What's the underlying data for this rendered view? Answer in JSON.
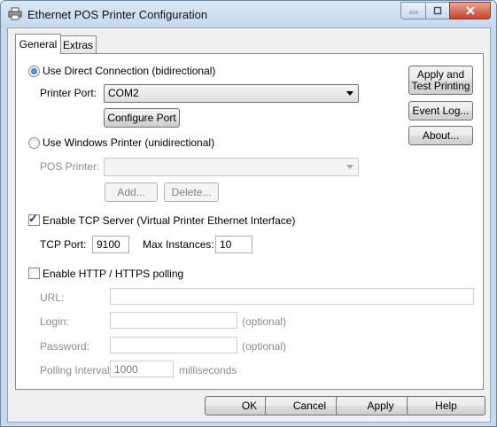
{
  "window": {
    "title": "Ethernet POS Printer Configuration"
  },
  "tabs": [
    {
      "label": "General"
    },
    {
      "label": "Extras"
    }
  ],
  "direct": {
    "radio_label": "Use Direct Connection (bidirectional)",
    "port_label": "Printer Port:",
    "port_value": "COM2",
    "configure_label": "Configure Port"
  },
  "windows_printer": {
    "radio_label": "Use Windows Printer (unidirectional)",
    "pos_label": "POS Printer:",
    "pos_value": "",
    "add_label": "Add...",
    "delete_label": "Delete..."
  },
  "tcp": {
    "check_label": "Enable TCP Server (Virtual Printer Ethernet Interface)",
    "port_label": "TCP Port:",
    "port_value": "9100",
    "max_label": "Max Instances:",
    "max_value": "10"
  },
  "http": {
    "check_label": "Enable HTTP / HTTPS polling",
    "url_label": "URL:",
    "url_value": "",
    "login_label": "Login:",
    "login_value": "",
    "optional1": "(optional)",
    "password_label": "Password:",
    "password_value": "",
    "optional2": "(optional)",
    "interval_label": "Polling Interval:",
    "interval_value": "1000",
    "interval_unit": "milliseconds"
  },
  "side_buttons": {
    "apply_test": "Apply and Test Printing",
    "event_log": "Event Log...",
    "about": "About..."
  },
  "footer": {
    "ok": "OK",
    "cancel": "Cancel",
    "apply": "Apply",
    "help": "Help"
  }
}
